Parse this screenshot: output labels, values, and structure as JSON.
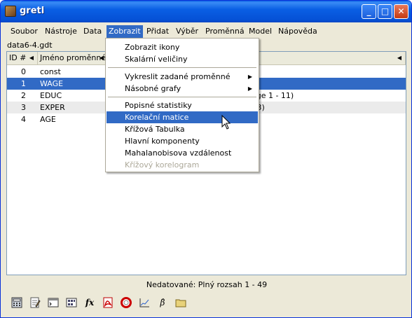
{
  "window": {
    "title": "gretl"
  },
  "menubar": {
    "items": [
      {
        "label": "Soubor"
      },
      {
        "label": "Nástroje"
      },
      {
        "label": "Data"
      },
      {
        "label": "Zobrazit"
      },
      {
        "label": "Přidat"
      },
      {
        "label": "Výběr"
      },
      {
        "label": "Proměnná"
      },
      {
        "label": "Model"
      },
      {
        "label": "Nápověda"
      }
    ],
    "active": "Zobrazit"
  },
  "dataset": {
    "filename": "data6-4.gdt"
  },
  "list": {
    "columns": [
      "ID #",
      "Jméno proměnné",
      ""
    ],
    "rows": [
      {
        "id": "0",
        "name": "const",
        "label": ""
      },
      {
        "id": "1",
        "name": "WAGE",
        "label": ""
      },
      {
        "id": "2",
        "name": "EDUC",
        "label": "ange 1 - 11)"
      },
      {
        "id": "3",
        "name": "EXPER",
        "label": "- 23)"
      },
      {
        "id": "4",
        "name": "AGE",
        "label": ""
      }
    ]
  },
  "status": {
    "text": "Nedatované: Plný rozsah 1 - 49"
  },
  "toolbar": {
    "icons": [
      "calculator-icon",
      "notepad-icon",
      "console-icon",
      "session-icon",
      "function-icon",
      "pdf-help-icon",
      "lifebuoy-icon",
      "graph-icon",
      "beta-icon",
      "folder-icon"
    ],
    "fx_glyph": "fx",
    "beta_glyph": "β̂"
  },
  "dropdown": {
    "items": [
      {
        "label": "Zobrazit ikony",
        "submenu": false,
        "disabled": false
      },
      {
        "label": "Skalární veličiny",
        "submenu": false,
        "disabled": false
      },
      {
        "separator": true
      },
      {
        "label": "Vykreslit zadané proměnné",
        "submenu": true,
        "disabled": false
      },
      {
        "label": "Násobné grafy",
        "submenu": true,
        "disabled": false
      },
      {
        "separator": true
      },
      {
        "label": "Popisné statistiky",
        "submenu": false,
        "disabled": false
      },
      {
        "label": "Korelační matice",
        "submenu": false,
        "disabled": false,
        "highlighted": true
      },
      {
        "label": "Křížová Tabulka",
        "submenu": false,
        "disabled": false
      },
      {
        "label": "Hlavní komponenty",
        "submenu": false,
        "disabled": false
      },
      {
        "label": "Mahalanobisova vzdálenost",
        "submenu": false,
        "disabled": false
      },
      {
        "label": "Křížový korelogram",
        "submenu": false,
        "disabled": true
      }
    ]
  },
  "colors": {
    "titlebar": "#0a5fe4",
    "selection": "#316ac5",
    "face": "#ece9d8"
  }
}
